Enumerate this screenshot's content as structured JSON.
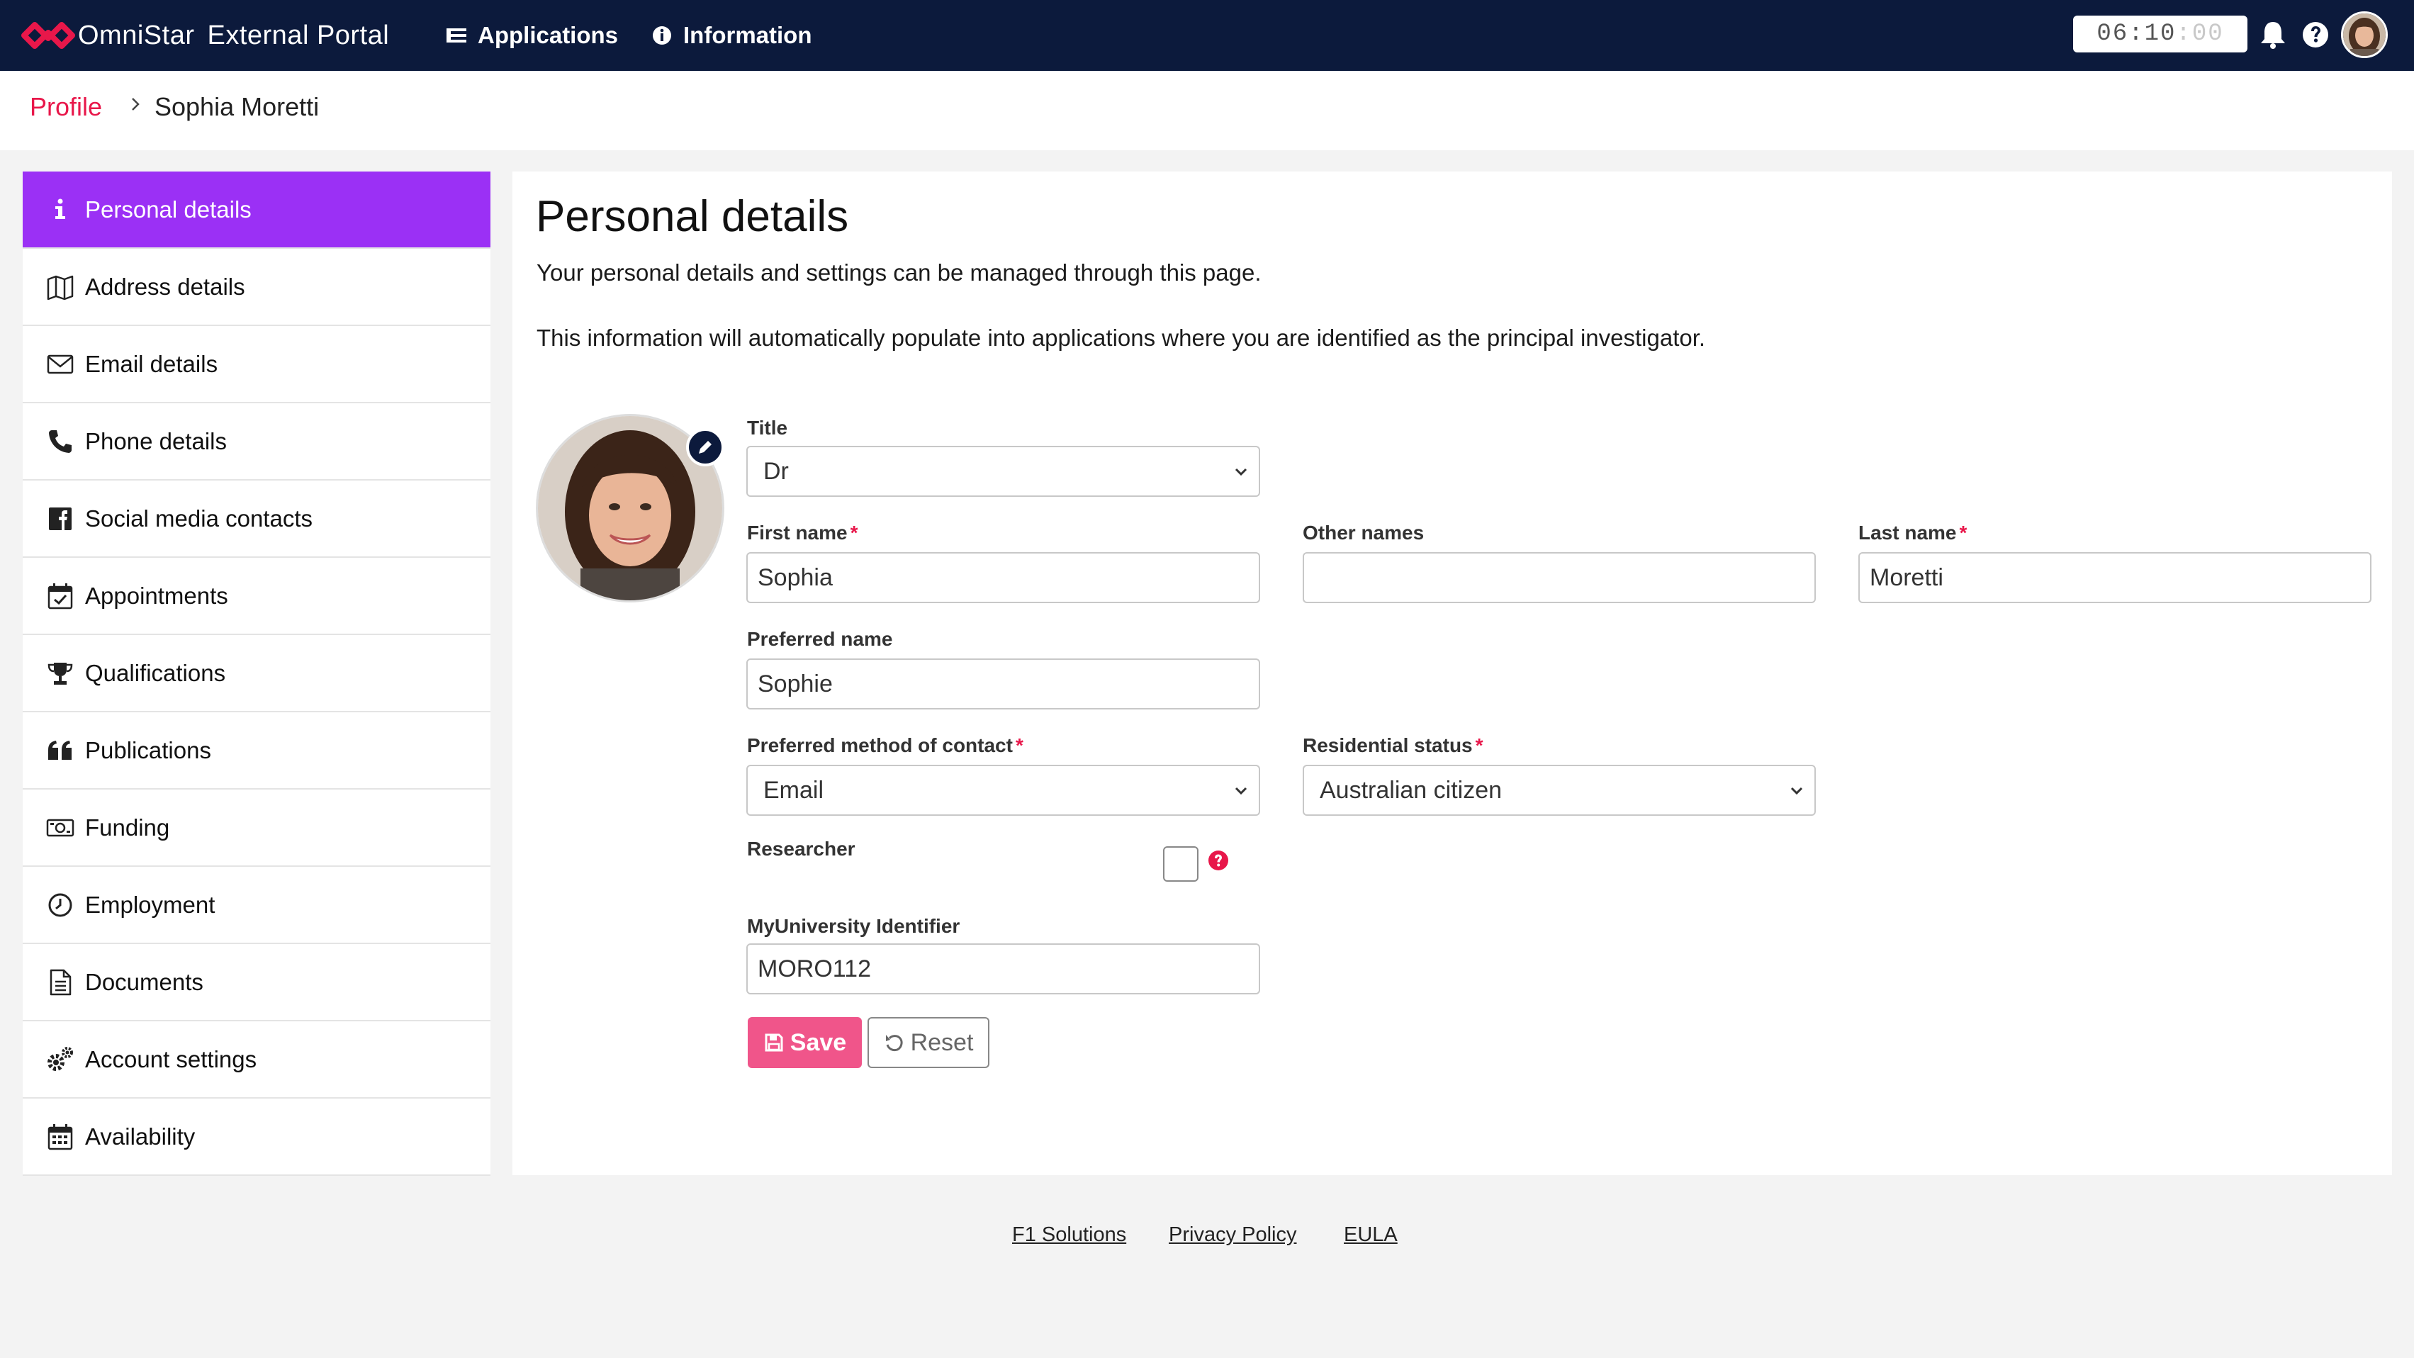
{
  "app": {
    "brand_name": "OmniStar",
    "portal_name": "External Portal",
    "brand_color": "#e8174a",
    "navbar_color": "#0c1a3c"
  },
  "nav": {
    "applications": "Applications",
    "information": "Information"
  },
  "timer": {
    "hours": "06",
    "minutes": "10",
    "seconds": "00"
  },
  "breadcrumb": {
    "parent": "Profile",
    "current": "Sophia Moretti"
  },
  "sidebar": {
    "active_color": "#9b30f5",
    "items": [
      {
        "label": "Personal details",
        "icon": "info-icon"
      },
      {
        "label": "Address details",
        "icon": "map-icon"
      },
      {
        "label": "Email details",
        "icon": "envelope-icon"
      },
      {
        "label": "Phone details",
        "icon": "phone-icon"
      },
      {
        "label": "Social media contacts",
        "icon": "facebook-icon"
      },
      {
        "label": "Appointments",
        "icon": "calendar-check-icon"
      },
      {
        "label": "Qualifications",
        "icon": "trophy-icon"
      },
      {
        "label": "Publications",
        "icon": "quote-icon"
      },
      {
        "label": "Funding",
        "icon": "money-icon"
      },
      {
        "label": "Employment",
        "icon": "clock-icon"
      },
      {
        "label": "Documents",
        "icon": "document-icon"
      },
      {
        "label": "Account settings",
        "icon": "gears-icon"
      },
      {
        "label": "Availability",
        "icon": "calendar-icon"
      }
    ]
  },
  "main": {
    "title": "Personal details",
    "intro_line1": "Your personal details and settings can be managed through this page.",
    "intro_line2": "This information will automatically populate into applications where you are identified as the principal investigator."
  },
  "form": {
    "title_label": "Title",
    "title_value": "Dr",
    "first_name_label": "First name",
    "first_name_value": "Sophia",
    "other_names_label": "Other names",
    "other_names_value": "",
    "last_name_label": "Last name",
    "last_name_value": "Moretti",
    "preferred_name_label": "Preferred name",
    "preferred_name_value": "Sophie",
    "contact_method_label": "Preferred method of contact",
    "contact_method_value": "Email",
    "residential_status_label": "Residential status",
    "residential_status_value": "Australian citizen",
    "researcher_label": "Researcher",
    "researcher_checked": false,
    "identifier_label": "MyUniversity Identifier",
    "identifier_value": "MORO112",
    "required_mark": "*",
    "save_label": "Save",
    "reset_label": "Reset"
  },
  "footer": {
    "link1": "F1 Solutions",
    "link2": "Privacy Policy",
    "link3": "EULA"
  }
}
